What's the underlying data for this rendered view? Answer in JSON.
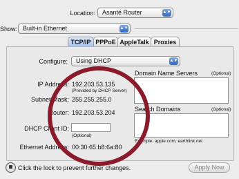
{
  "location": {
    "label": "Location:",
    "value": "Asanté Router"
  },
  "show": {
    "label": "Show:",
    "value": "Built-in Ethernet"
  },
  "tabs": [
    {
      "label": "TCP/IP",
      "active": true
    },
    {
      "label": "PPPoE",
      "active": false
    },
    {
      "label": "AppleTalk",
      "active": false
    },
    {
      "label": "Proxies",
      "active": false
    }
  ],
  "configure": {
    "label": "Configure:",
    "value": "Using DHCP"
  },
  "ip": {
    "label": "IP Address:",
    "value": "192.203.53.135",
    "note": "(Provided by DHCP Server)"
  },
  "subnet": {
    "label": "Subnet Mask:",
    "value": "255.255.255.0"
  },
  "router": {
    "label": "Router:",
    "value": "192.203.53.204"
  },
  "dhcp": {
    "label": "DHCP Client ID:",
    "value": "",
    "note": "(Optional)"
  },
  "ethernet": {
    "label": "Ethernet Address:",
    "value": "00:30:65:b8:6a:80"
  },
  "dns": {
    "label": "Domain Name Servers",
    "optional": "(Optional)"
  },
  "search": {
    "label": "Search Domains",
    "optional": "(Optional)"
  },
  "example": "Example: apple.com, earthlink.net",
  "lock_text": "Click the lock to prevent further changes.",
  "apply_button": "Apply Now",
  "colors": {
    "annotation_circle": "#8b1a2a",
    "active_tab": "#a9c4ec"
  },
  "icons": {
    "popup_arrow": "updown-arrows-icon",
    "lock": "lock-icon"
  }
}
